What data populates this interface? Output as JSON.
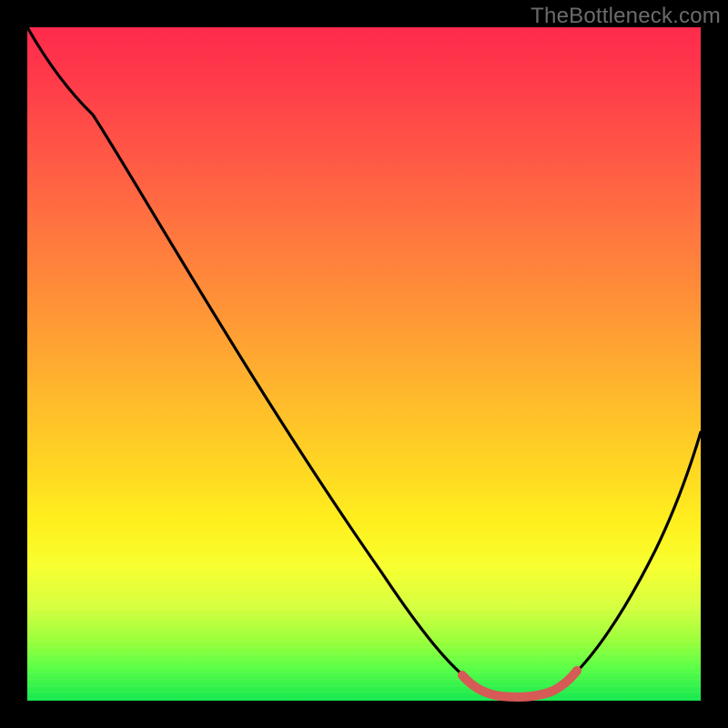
{
  "watermark": "TheBottleneck.com",
  "colors": {
    "background": "#000000",
    "gradient_top": "#ff2a4c",
    "gradient_mid1": "#ff9a35",
    "gradient_mid2": "#ffee1e",
    "gradient_bottom": "#16e84f",
    "curve_black": "#000000",
    "highlight_red": "#d65a56"
  },
  "chart_data": {
    "type": "line",
    "title": "",
    "xlabel": "",
    "ylabel": "",
    "xlim": [
      0,
      100
    ],
    "ylim": [
      0,
      100
    ],
    "series": [
      {
        "name": "bottleneck-curve",
        "x": [
          0,
          4,
          10,
          20,
          30,
          40,
          50,
          60,
          65,
          68,
          72,
          76,
          80,
          85,
          90,
          95,
          100
        ],
        "y": [
          100,
          96,
          89,
          75,
          61,
          47,
          33,
          19,
          10,
          4,
          1,
          1,
          3,
          9,
          20,
          33,
          47
        ]
      }
    ],
    "annotations": [
      {
        "name": "optimal-range-highlight",
        "x_range": [
          65,
          80
        ],
        "y_level": 2,
        "color": "#d65a56"
      }
    ]
  }
}
